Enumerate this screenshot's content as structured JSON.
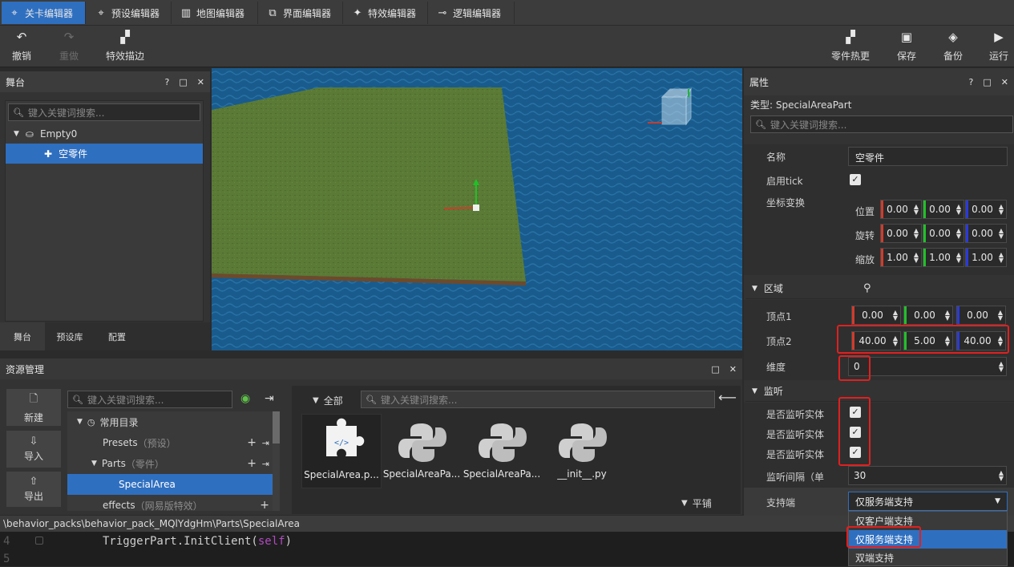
{
  "tabs": [
    {
      "label": "关卡编辑器",
      "icon": "target-icon"
    },
    {
      "label": "预设编辑器",
      "icon": "target-icon"
    },
    {
      "label": "地图编辑器",
      "icon": "map-icon"
    },
    {
      "label": "界面编辑器",
      "icon": "window-icon"
    },
    {
      "label": "特效编辑器",
      "icon": "sparkle-icon"
    },
    {
      "label": "逻辑编辑器",
      "icon": "logic-icon"
    }
  ],
  "toolbar": {
    "undo": "撤销",
    "redo": "重做",
    "effect_outline": "特效描边",
    "part_hotupdate": "零件热更",
    "save": "保存",
    "backup": "备份",
    "run": "运行"
  },
  "stage": {
    "title": "舞台",
    "search_placeholder": "键入关键词搜索...",
    "tree": [
      {
        "label": "Empty0"
      },
      {
        "label": "空零件"
      }
    ],
    "bottom_tabs": [
      "舞台",
      "预设库",
      "配置"
    ]
  },
  "assets": {
    "title": "资源管理",
    "side_buttons": [
      "新建",
      "导入",
      "导出"
    ],
    "search_placeholder": "键入关键词搜索...",
    "tree": [
      {
        "label": "常用目录",
        "sub": ""
      },
      {
        "label": "Presets",
        "sub": "（预设）"
      },
      {
        "label": "Parts",
        "sub": "（零件）"
      },
      {
        "label": "SpecialArea",
        "sub": ""
      },
      {
        "label": "effects",
        "sub": "（网易版特效）"
      }
    ],
    "filter_label": "全部",
    "files_search_placeholder": "键入关键词搜索...",
    "files": [
      {
        "name": "SpecialArea.p..."
      },
      {
        "name": "SpecialAreaPa..."
      },
      {
        "name": "SpecialAreaPa..."
      },
      {
        "name": "__init__.py"
      }
    ],
    "tile_label": "平铺"
  },
  "code": {
    "path": "\\behavior_packs\\behavior_pack_MQlYdgHm\\Parts\\SpecialArea",
    "lines": [
      {
        "no": "4",
        "text": "TriggerPart.InitClient(",
        "arg": "self",
        "end": ")"
      },
      {
        "no": "5",
        "text": "",
        "arg": "",
        "end": ""
      }
    ]
  },
  "props": {
    "title": "属性",
    "type_label": "类型: SpecialAreaPart",
    "search_placeholder": "键入关键词搜索...",
    "name_label": "名称",
    "name_value": "空零件",
    "tick_label": "启用tick",
    "transform_label": "坐标变换",
    "position_label": "位置",
    "rotation_label": "旋转",
    "scale_label": "缩放",
    "position": [
      "0.00",
      "0.00",
      "0.00"
    ],
    "rotation": [
      "0.00",
      "0.00",
      "0.00"
    ],
    "scale": [
      "1.00",
      "1.00",
      "1.00"
    ],
    "region_section": "区域",
    "vertex1_label": "顶点1",
    "vertex1": [
      "0.00",
      "0.00",
      "0.00"
    ],
    "vertex2_label": "顶点2",
    "vertex2": [
      "40.00",
      "5.00",
      "40.00"
    ],
    "dimension_label": "维度",
    "dimension_value": "0",
    "listen_section": "监听",
    "listen_entity_labels": [
      "是否监听实体",
      "是否监听实体",
      "是否监听实体"
    ],
    "interval_label": "监听间隔（单",
    "interval_value": "30",
    "support_label": "支持端",
    "support_value": "仅服务端支持",
    "support_options": [
      "仅客户端支持",
      "仅服务端支持",
      "双端支持"
    ]
  },
  "colors": {
    "accent": "#2f6fc0",
    "x_axis": "#d23b2b",
    "y_axis": "#22c02a",
    "z_axis": "#2a3ad8",
    "highlight_box": "#e02020"
  }
}
